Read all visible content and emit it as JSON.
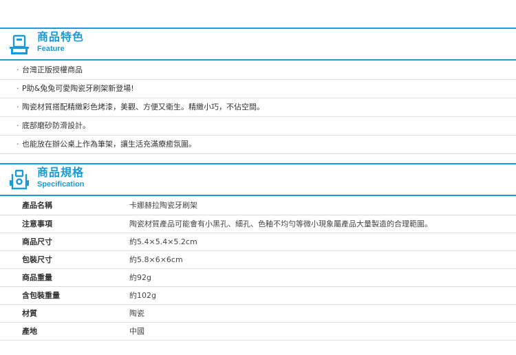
{
  "colors": {
    "accent": "#1a9ad6",
    "divider": "#dcdcdc",
    "text": "#333333"
  },
  "feature": {
    "icon": "shop-counter-icon",
    "title_cn": "商品特色",
    "title_en": "Feature",
    "items": [
      "台灣正版授權商品",
      "P助&兔兔可愛陶瓷牙刷架新登場!",
      "陶瓷材質搭配精緻彩色烤漆，美觀、方便又衛生。精緻小巧，不佔空間。",
      "底部磨砂防滑設計。",
      "也能放在辦公桌上作為筆架，讓生活充滿療癒氛圍。"
    ]
  },
  "spec": {
    "icon": "document-clip-icon",
    "title_cn": "商品規格",
    "title_en": "Specification",
    "rows": [
      {
        "label": "產品名稱",
        "value": "卡娜赫拉陶瓷牙刷架"
      },
      {
        "label": "注意事項",
        "value": "陶瓷材質產品可能會有小黑孔、細孔、色釉不均勻等微小現象屬產品大量製造的合理範圍。"
      },
      {
        "label": "商品尺寸",
        "value": "約5.4×5.4×5.2cm"
      },
      {
        "label": "包裝尺寸",
        "value": "約5.8×6×6cm"
      },
      {
        "label": "商品重量",
        "value": "約92g"
      },
      {
        "label": "含包裝重量",
        "value": "約102g"
      },
      {
        "label": "材質",
        "value": "陶瓷"
      },
      {
        "label": "產地",
        "value": "中國"
      }
    ]
  }
}
